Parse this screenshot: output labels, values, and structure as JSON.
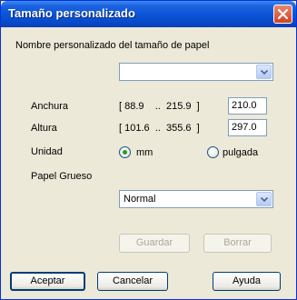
{
  "window": {
    "title": "Tamaño personalizado"
  },
  "custom_name": {
    "label": "Nombre personalizado del tamaño de papel",
    "value": ""
  },
  "width": {
    "label": "Anchura",
    "range": "[ 88.9    ..  215.9  ]",
    "value": "210.0"
  },
  "height": {
    "label": "Altura",
    "range": "[ 101.6  ..  355.6  ]",
    "value": "297.0"
  },
  "unit": {
    "label": "Unidad",
    "options": [
      "mm",
      "pulgada"
    ],
    "selected": "mm"
  },
  "thick_paper": {
    "label": "Papel Grueso",
    "value": "Normal"
  },
  "buttons": {
    "save": "Guardar",
    "delete": "Borrar",
    "ok": "Aceptar",
    "cancel": "Cancelar",
    "help": "Ayuda"
  }
}
